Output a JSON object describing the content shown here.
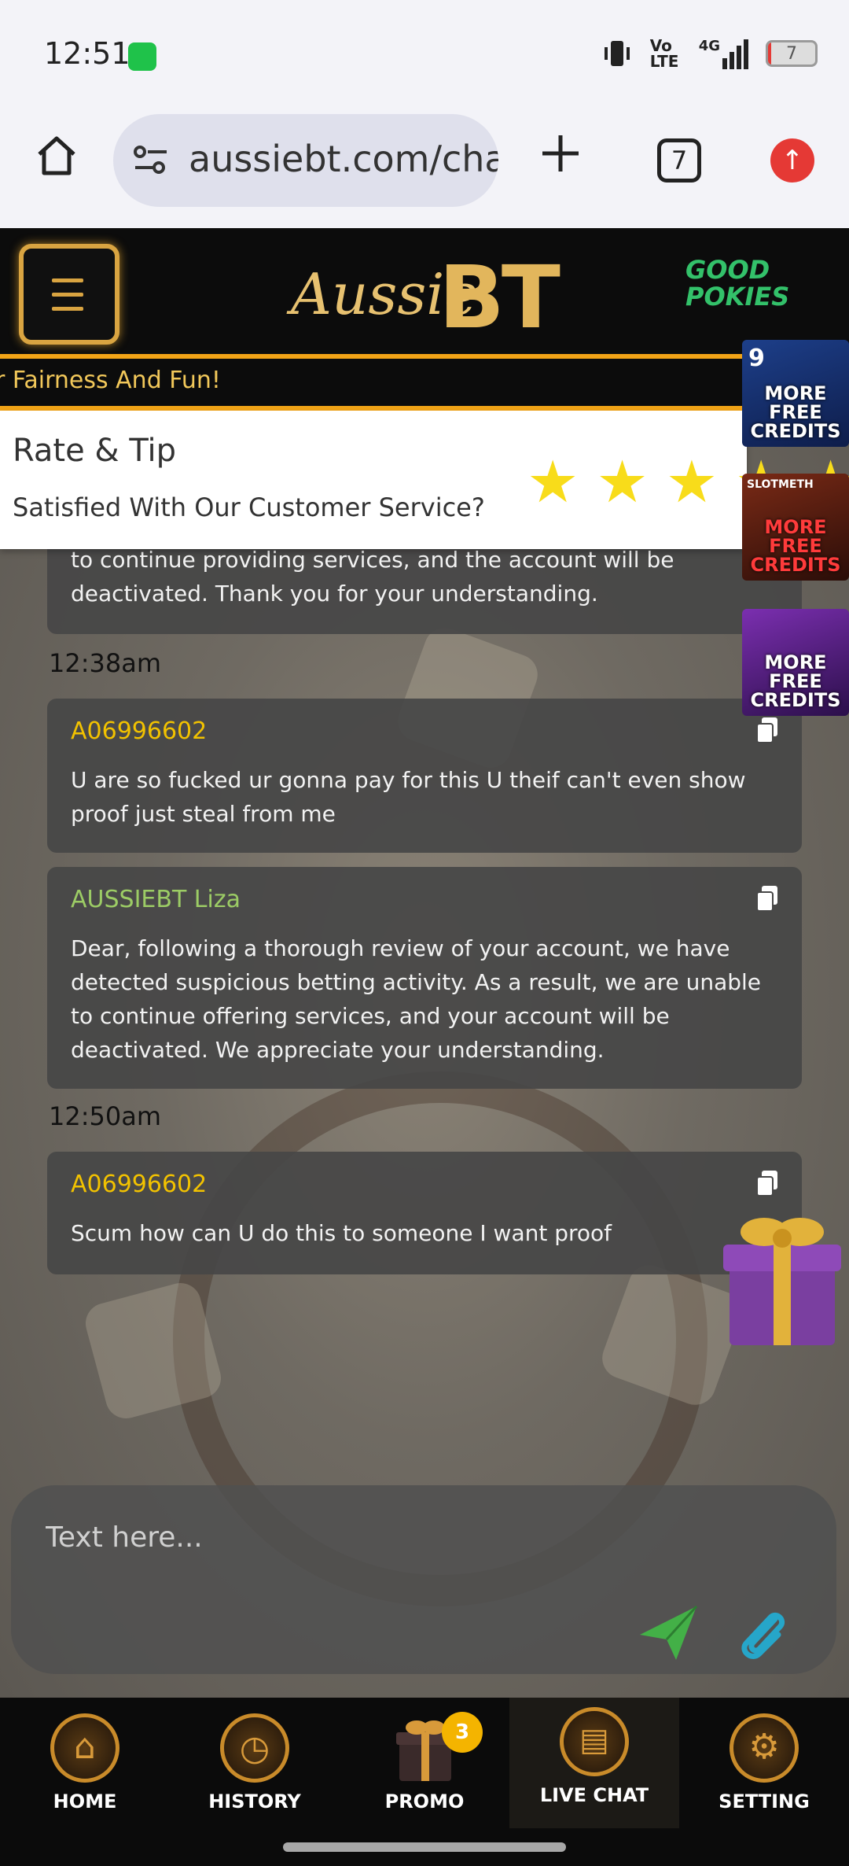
{
  "status_bar": {
    "time": "12:51",
    "network": "4G",
    "volte": "Vo LTE",
    "battery": "7",
    "battery_level": 0.07
  },
  "browser": {
    "url": "aussiebt.com/chat",
    "tab_count": "7"
  },
  "site": {
    "logo_script": "Aussie",
    "logo_mark": "BT",
    "partner_line1": "GOOD",
    "partner_line2": "POKIES",
    "ticker": "r Fairness And Fun!"
  },
  "rate_panel": {
    "title": "Rate & Tip",
    "subtitle": "Satisfied With Our Customer Service?",
    "stars": 5
  },
  "messages": [
    {
      "text": "to continue providing services, and the account will be deactivated. Thank you for your understanding."
    },
    {
      "time": "12:38am"
    },
    {
      "sender": "A06996602",
      "text": "U are so fucked ur gonna pay for this U theif can't even show proof just steal from me"
    },
    {
      "sender": "AUSSIEBT Liza",
      "text": "Dear, following a thorough review of your account, we have detected suspicious betting activity. As a result, we are unable to continue offering services, and your account will be deactivated. We appreciate your understanding."
    },
    {
      "time": "12:50am"
    },
    {
      "sender": "A06996602",
      "text": "Scum how can U do this to someone I want proof"
    }
  ],
  "ads": [
    {
      "label": "MORE FREE CREDITS",
      "badge": "9"
    },
    {
      "label": "MORE FREE CREDITS",
      "badge": "SLOTMETH"
    },
    {
      "label": "MORE FREE CREDITS"
    }
  ],
  "input": {
    "placeholder": "Text here..."
  },
  "nav": [
    {
      "label": "HOME"
    },
    {
      "label": "HISTORY"
    },
    {
      "label": "PROMO",
      "badge": "3"
    },
    {
      "label": "LIVE CHAT"
    },
    {
      "label": "SETTING"
    }
  ],
  "colors": {
    "accent_gold": "#d9a441",
    "customer_sender": "#f2c200",
    "agent_sender": "#9ccc65",
    "send_green": "#43b047",
    "attach_cyan": "#26a6c9",
    "star_yellow": "#f8dc1a"
  }
}
